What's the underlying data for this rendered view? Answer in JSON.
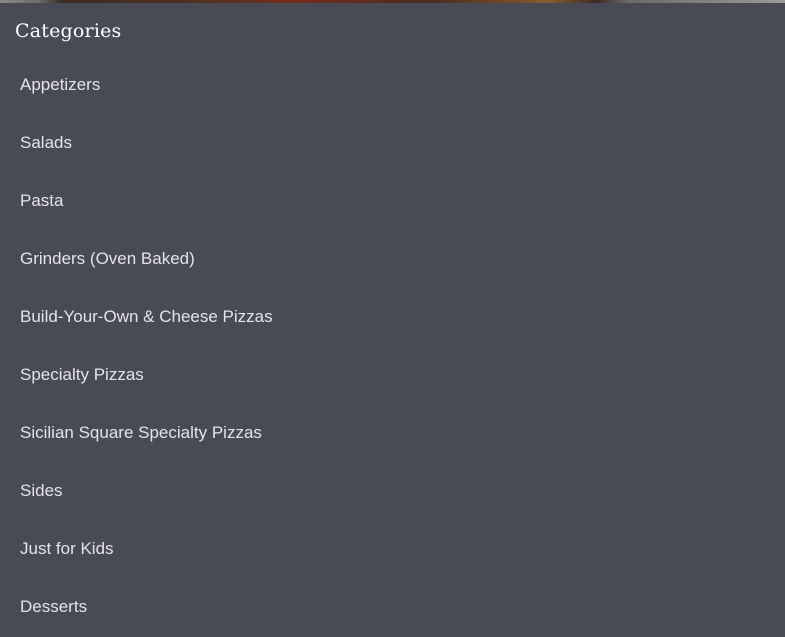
{
  "sidebar": {
    "title": "Categories",
    "items": [
      {
        "label": "Appetizers"
      },
      {
        "label": "Salads"
      },
      {
        "label": "Pasta"
      },
      {
        "label": "Grinders (Oven Baked)"
      },
      {
        "label": "Build-Your-Own & Cheese Pizzas"
      },
      {
        "label": "Specialty Pizzas"
      },
      {
        "label": "Sicilian Square Specialty Pizzas"
      },
      {
        "label": "Sides"
      },
      {
        "label": "Just for Kids"
      },
      {
        "label": "Desserts"
      }
    ]
  }
}
